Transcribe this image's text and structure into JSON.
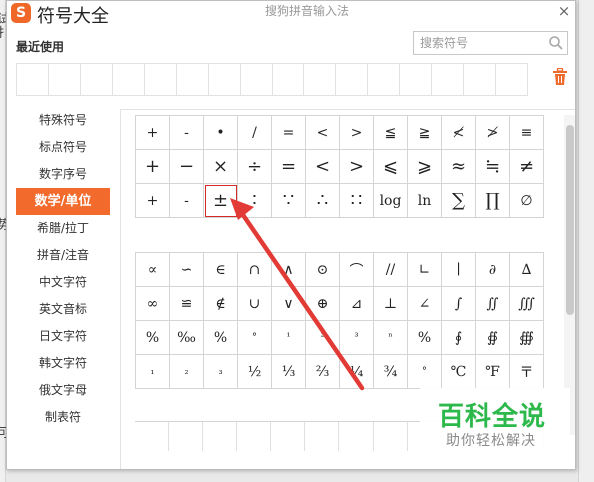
{
  "window": {
    "app_title": "符号大全",
    "caption": "搜狗拼音输入法",
    "logo_letter": "S",
    "close_glyph": "×"
  },
  "background": {
    "edge_glyphs": [
      "试",
      "扌",
      "势",
      "可"
    ]
  },
  "recent": {
    "label": "最近使用"
  },
  "search": {
    "placeholder": "搜索符号"
  },
  "sidebar": {
    "items": [
      {
        "label": "特殊符号"
      },
      {
        "label": "标点符号"
      },
      {
        "label": "数字序号"
      },
      {
        "label": "数学/单位",
        "active": true
      },
      {
        "label": "希腊/拉丁"
      },
      {
        "label": "拼音/注音"
      },
      {
        "label": "中文字符"
      },
      {
        "label": "英文音标"
      },
      {
        "label": "日文字符"
      },
      {
        "label": "韩文字符"
      },
      {
        "label": "俄文字母"
      },
      {
        "label": "制表符"
      }
    ]
  },
  "math_symbols": [
    [
      "+",
      "-",
      "•",
      "/",
      "=",
      "<",
      ">",
      "≦",
      "≧",
      "≮",
      "≯",
      "≡"
    ],
    [
      "+",
      "−",
      "×",
      "÷",
      "=",
      "<",
      ">",
      "⩽",
      "⩾",
      "≈",
      "≒",
      "≠"
    ],
    [
      "+",
      "-",
      "±",
      "∶",
      "∵",
      "∴",
      "∷",
      "log",
      "ln",
      "∑",
      "∏",
      "∅"
    ]
  ],
  "unit_symbols": [
    [
      "∝",
      "∽",
      "∈",
      "∩",
      "∧",
      "⊙",
      "⌒",
      "//",
      "∟",
      "∣",
      "∂",
      "∆"
    ],
    [
      "∞",
      "≌",
      "∉",
      "∪",
      "∨",
      "⊕",
      "⊿",
      "⊥",
      "∠",
      "∫",
      "∬",
      "∭"
    ],
    [
      "%",
      "‰",
      "%",
      "°",
      "¹",
      "²",
      "³",
      "ⁿ",
      "%",
      "∮",
      "∯",
      "∰"
    ],
    [
      "₁",
      "₂",
      "₃",
      "½",
      "⅓",
      "⅔",
      "¼",
      "¾",
      "°",
      "℃",
      "℉",
      "〒"
    ]
  ],
  "watermark": {
    "title": "百科全说",
    "subtitle": "助你轻松解决"
  },
  "colors": {
    "accent": "#f26b2d",
    "highlight_border": "#d42a2a",
    "watermark_green": "#2db84c"
  }
}
